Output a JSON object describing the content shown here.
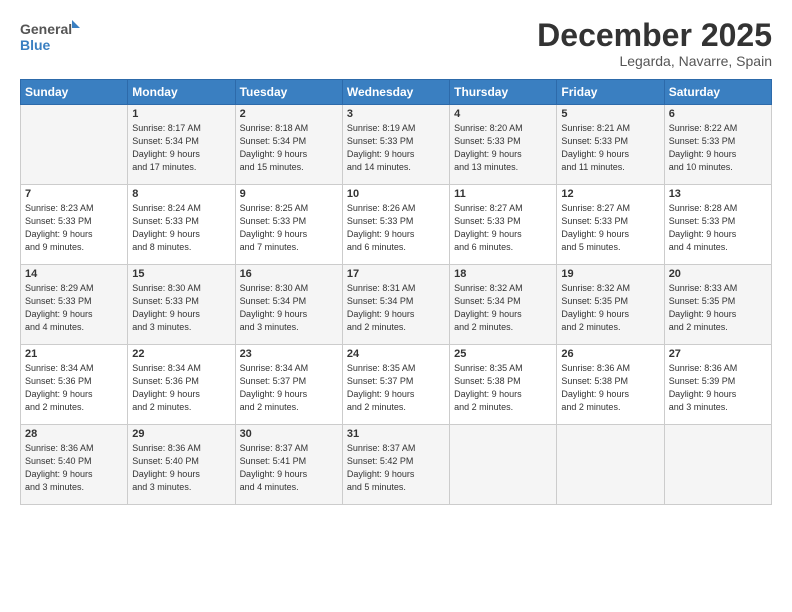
{
  "logo": {
    "line1": "General",
    "line2": "Blue"
  },
  "title": "December 2025",
  "subtitle": "Legarda, Navarre, Spain",
  "days_of_week": [
    "Sunday",
    "Monday",
    "Tuesday",
    "Wednesday",
    "Thursday",
    "Friday",
    "Saturday"
  ],
  "weeks": [
    [
      {
        "day": "",
        "info": ""
      },
      {
        "day": "1",
        "info": "Sunrise: 8:17 AM\nSunset: 5:34 PM\nDaylight: 9 hours\nand 17 minutes."
      },
      {
        "day": "2",
        "info": "Sunrise: 8:18 AM\nSunset: 5:34 PM\nDaylight: 9 hours\nand 15 minutes."
      },
      {
        "day": "3",
        "info": "Sunrise: 8:19 AM\nSunset: 5:33 PM\nDaylight: 9 hours\nand 14 minutes."
      },
      {
        "day": "4",
        "info": "Sunrise: 8:20 AM\nSunset: 5:33 PM\nDaylight: 9 hours\nand 13 minutes."
      },
      {
        "day": "5",
        "info": "Sunrise: 8:21 AM\nSunset: 5:33 PM\nDaylight: 9 hours\nand 11 minutes."
      },
      {
        "day": "6",
        "info": "Sunrise: 8:22 AM\nSunset: 5:33 PM\nDaylight: 9 hours\nand 10 minutes."
      }
    ],
    [
      {
        "day": "7",
        "info": "Sunrise: 8:23 AM\nSunset: 5:33 PM\nDaylight: 9 hours\nand 9 minutes."
      },
      {
        "day": "8",
        "info": "Sunrise: 8:24 AM\nSunset: 5:33 PM\nDaylight: 9 hours\nand 8 minutes."
      },
      {
        "day": "9",
        "info": "Sunrise: 8:25 AM\nSunset: 5:33 PM\nDaylight: 9 hours\nand 7 minutes."
      },
      {
        "day": "10",
        "info": "Sunrise: 8:26 AM\nSunset: 5:33 PM\nDaylight: 9 hours\nand 6 minutes."
      },
      {
        "day": "11",
        "info": "Sunrise: 8:27 AM\nSunset: 5:33 PM\nDaylight: 9 hours\nand 6 minutes."
      },
      {
        "day": "12",
        "info": "Sunrise: 8:27 AM\nSunset: 5:33 PM\nDaylight: 9 hours\nand 5 minutes."
      },
      {
        "day": "13",
        "info": "Sunrise: 8:28 AM\nSunset: 5:33 PM\nDaylight: 9 hours\nand 4 minutes."
      }
    ],
    [
      {
        "day": "14",
        "info": "Sunrise: 8:29 AM\nSunset: 5:33 PM\nDaylight: 9 hours\nand 4 minutes."
      },
      {
        "day": "15",
        "info": "Sunrise: 8:30 AM\nSunset: 5:33 PM\nDaylight: 9 hours\nand 3 minutes."
      },
      {
        "day": "16",
        "info": "Sunrise: 8:30 AM\nSunset: 5:34 PM\nDaylight: 9 hours\nand 3 minutes."
      },
      {
        "day": "17",
        "info": "Sunrise: 8:31 AM\nSunset: 5:34 PM\nDaylight: 9 hours\nand 2 minutes."
      },
      {
        "day": "18",
        "info": "Sunrise: 8:32 AM\nSunset: 5:34 PM\nDaylight: 9 hours\nand 2 minutes."
      },
      {
        "day": "19",
        "info": "Sunrise: 8:32 AM\nSunset: 5:35 PM\nDaylight: 9 hours\nand 2 minutes."
      },
      {
        "day": "20",
        "info": "Sunrise: 8:33 AM\nSunset: 5:35 PM\nDaylight: 9 hours\nand 2 minutes."
      }
    ],
    [
      {
        "day": "21",
        "info": "Sunrise: 8:34 AM\nSunset: 5:36 PM\nDaylight: 9 hours\nand 2 minutes."
      },
      {
        "day": "22",
        "info": "Sunrise: 8:34 AM\nSunset: 5:36 PM\nDaylight: 9 hours\nand 2 minutes."
      },
      {
        "day": "23",
        "info": "Sunrise: 8:34 AM\nSunset: 5:37 PM\nDaylight: 9 hours\nand 2 minutes."
      },
      {
        "day": "24",
        "info": "Sunrise: 8:35 AM\nSunset: 5:37 PM\nDaylight: 9 hours\nand 2 minutes."
      },
      {
        "day": "25",
        "info": "Sunrise: 8:35 AM\nSunset: 5:38 PM\nDaylight: 9 hours\nand 2 minutes."
      },
      {
        "day": "26",
        "info": "Sunrise: 8:36 AM\nSunset: 5:38 PM\nDaylight: 9 hours\nand 2 minutes."
      },
      {
        "day": "27",
        "info": "Sunrise: 8:36 AM\nSunset: 5:39 PM\nDaylight: 9 hours\nand 3 minutes."
      }
    ],
    [
      {
        "day": "28",
        "info": "Sunrise: 8:36 AM\nSunset: 5:40 PM\nDaylight: 9 hours\nand 3 minutes."
      },
      {
        "day": "29",
        "info": "Sunrise: 8:36 AM\nSunset: 5:40 PM\nDaylight: 9 hours\nand 3 minutes."
      },
      {
        "day": "30",
        "info": "Sunrise: 8:37 AM\nSunset: 5:41 PM\nDaylight: 9 hours\nand 4 minutes."
      },
      {
        "day": "31",
        "info": "Sunrise: 8:37 AM\nSunset: 5:42 PM\nDaylight: 9 hours\nand 5 minutes."
      },
      {
        "day": "",
        "info": ""
      },
      {
        "day": "",
        "info": ""
      },
      {
        "day": "",
        "info": ""
      }
    ]
  ]
}
